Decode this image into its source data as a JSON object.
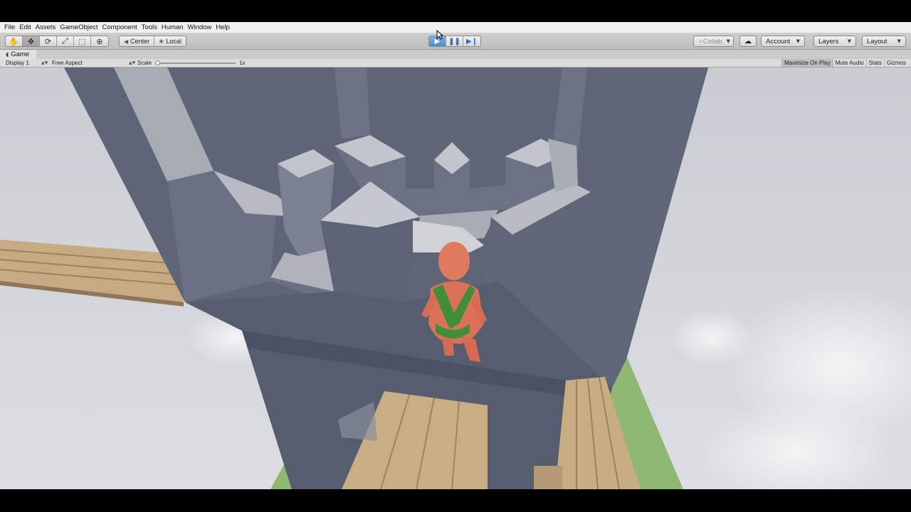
{
  "menu": [
    "File",
    "Edit",
    "Assets",
    "GameObject",
    "Component",
    "Tools",
    "Human",
    "Window",
    "Help"
  ],
  "toolbar": {
    "tools": [
      {
        "name": "hand-tool",
        "glyph": "✋"
      },
      {
        "name": "move-tool",
        "glyph": "✥"
      },
      {
        "name": "rotate-tool",
        "glyph": "⟳"
      },
      {
        "name": "scale-tool",
        "glyph": "⤢"
      },
      {
        "name": "rect-tool",
        "glyph": "⬚"
      },
      {
        "name": "transform-tool",
        "glyph": "⊕"
      }
    ],
    "pivot_label": "Center",
    "space_label": "Local",
    "play_state": "playing"
  },
  "right_buttons": {
    "collab": "Collab",
    "account": "Account",
    "layers": "Layers",
    "layout": "Layout"
  },
  "tab": {
    "title": "Game"
  },
  "game_bar": {
    "display": "Display 1",
    "aspect": "Free Aspect",
    "scale_label": "Scale",
    "scale_value": "1x",
    "toggles": [
      "Maximize On Play",
      "Mute Audio",
      "Stats",
      "Gizmos"
    ],
    "maximize_active": true
  },
  "colors": {
    "sky": "#d4d6da",
    "castle_dark": "#5f6678",
    "castle_light": "#a9adb6",
    "plank": "#c9ad84",
    "grass": "#8fb872",
    "human_body": "#e07a5f",
    "harness": "#3f8f3a",
    "play_blue": "#3b7fd6"
  }
}
